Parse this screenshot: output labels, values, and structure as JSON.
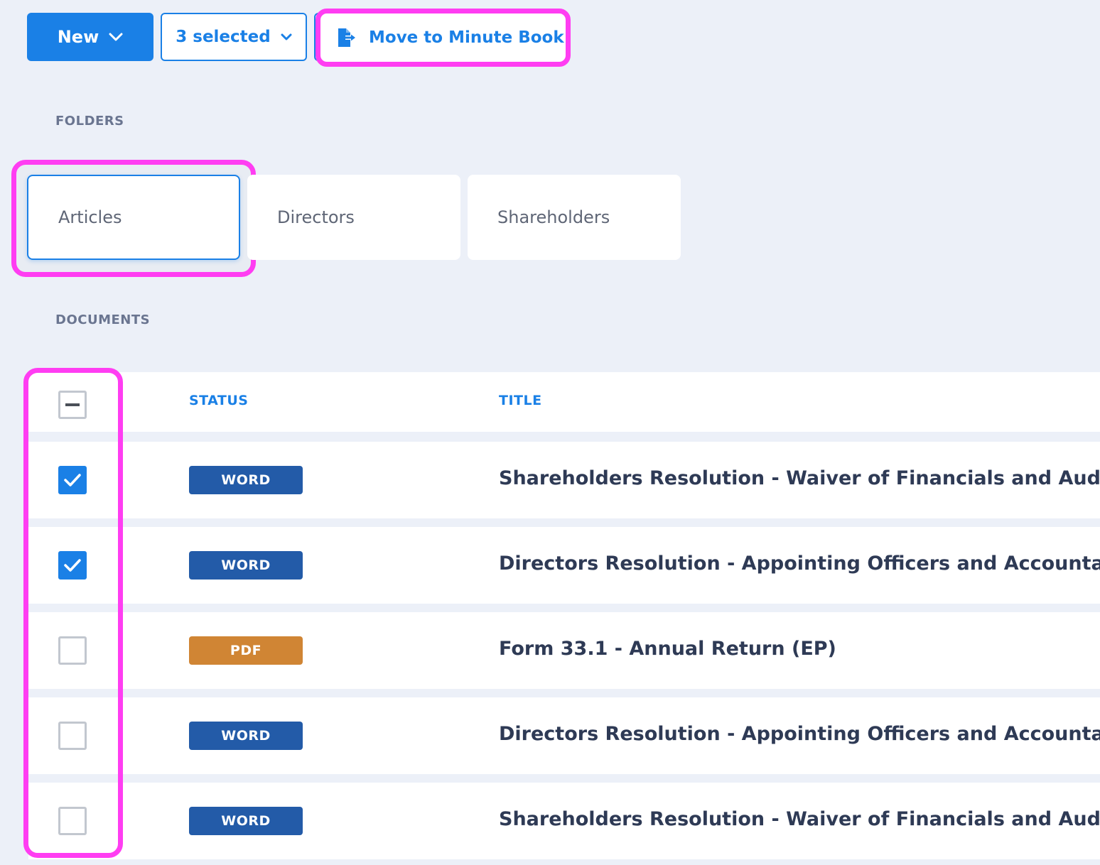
{
  "toolbar": {
    "new_label": "New",
    "selected_label": "3 selected",
    "move_label": "Move to Minute Book"
  },
  "folders": {
    "section_label": "FOLDERS",
    "items": [
      {
        "label": "Articles",
        "active": true
      },
      {
        "label": "Directors",
        "active": false
      },
      {
        "label": "Shareholders",
        "active": false
      }
    ]
  },
  "documents": {
    "section_label": "DOCUMENTS",
    "columns": {
      "status": "STATUS",
      "title": "TITLE"
    },
    "rows": [
      {
        "status": "WORD",
        "title": "Shareholders Resolution - Waiver of Financials and Auditor",
        "checked": true
      },
      {
        "status": "WORD",
        "title": "Directors Resolution - Appointing Officers and Accountant",
        "checked": true
      },
      {
        "status": "PDF",
        "title": "Form 33.1 - Annual Return (EP)",
        "checked": false
      },
      {
        "status": "WORD",
        "title": "Directors Resolution - Appointing Officers and Accountant",
        "checked": false
      },
      {
        "status": "WORD",
        "title": "Shareholders Resolution - Waiver of Financials and Auditor",
        "checked": false
      }
    ]
  },
  "colors": {
    "accent": "#1a80e6",
    "word_badge": "#235ba8",
    "pdf_badge": "#d08534",
    "highlight": "#ff3df2",
    "background": "#ecf0f8"
  },
  "icons": {
    "new_dropdown": "chevron-down-icon",
    "selected_dropdown": "chevron-down-icon",
    "move": "file-export-icon",
    "checked": "checkmark-icon",
    "select_all": "indeterminate-checkbox-icon"
  }
}
